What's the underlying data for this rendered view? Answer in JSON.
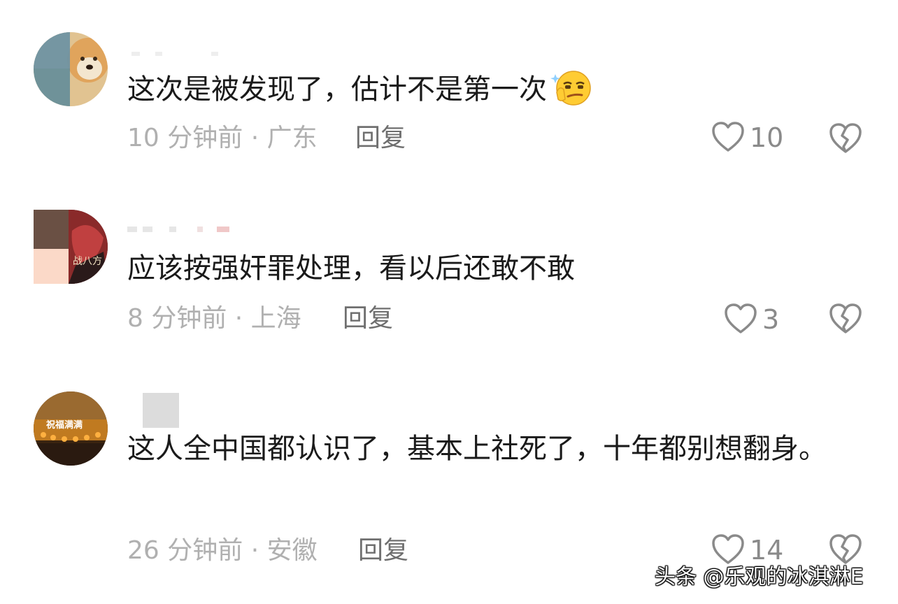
{
  "comments": [
    {
      "content": "这次是被发现了，估计不是第一次",
      "emoji": "thinking-smirk-emoji",
      "meta": "10 分钟前 · 广东",
      "reply_label": "回复",
      "likes": "10"
    },
    {
      "content": "应该按强奸罪处理，看以后还敢不敢",
      "meta": "8 分钟前 · 上海",
      "reply_label": "回复",
      "likes": "3"
    },
    {
      "content": "这人全中国都认识了，基本上社死了，十年都别想翻身。",
      "meta": "26 分钟前 · 安徽",
      "reply_label": "回复",
      "likes": "14"
    }
  ],
  "watermark": "头条 @乐观的冰淇淋E",
  "colors": {
    "text": "#1a1a1a",
    "meta": "#b0b0b0",
    "reply": "#6f6f6f",
    "icon": "#8a8a8a"
  }
}
